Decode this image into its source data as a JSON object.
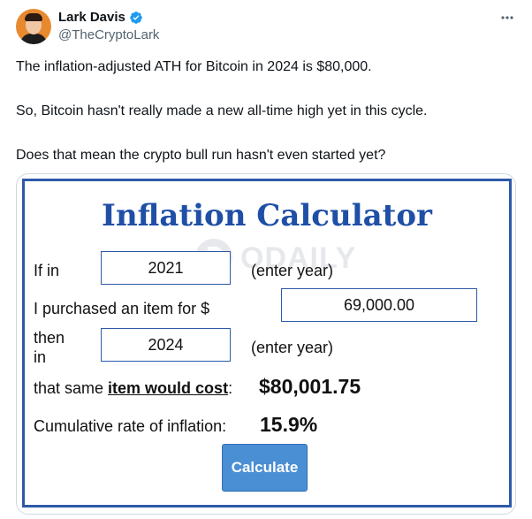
{
  "author": {
    "display_name": "Lark Davis",
    "handle": "@TheCryptoLark"
  },
  "tweet": {
    "paragraphs": [
      "The inflation-adjusted ATH for Bitcoin in 2024 is $80,000.",
      "So, Bitcoin hasn't really made a new all-time high yet in this cycle.",
      "Does that mean the crypto bull run hasn't even started yet?"
    ]
  },
  "calculator": {
    "title": "Inflation Calculator",
    "watermark": "ODAILY",
    "row1_label": "If in",
    "start_year": "2021",
    "row1_hint": "(enter year)",
    "row2_label": "I purchased an item for $",
    "amount": "69,000.00",
    "row3_label_line1": "then",
    "row3_label_line2": "in",
    "end_year": "2024",
    "row3_hint": "(enter year)",
    "cost_prefix": "that same ",
    "cost_link": "item would cost",
    "cost_suffix": ":",
    "cost_value": "$80,001.75",
    "rate_label": "Cumulative rate of inflation:",
    "rate_value": "15.9%",
    "button_label": "Calculate"
  },
  "colors": {
    "calc_border": "#2d5aa8",
    "title_blue": "#1f4fa6",
    "button_blue": "#4a8fd4",
    "verified_blue": "#1d9bf0"
  },
  "icons": [
    "verified-badge-icon",
    "more-options-icon",
    "odaily-logo-icon"
  ]
}
